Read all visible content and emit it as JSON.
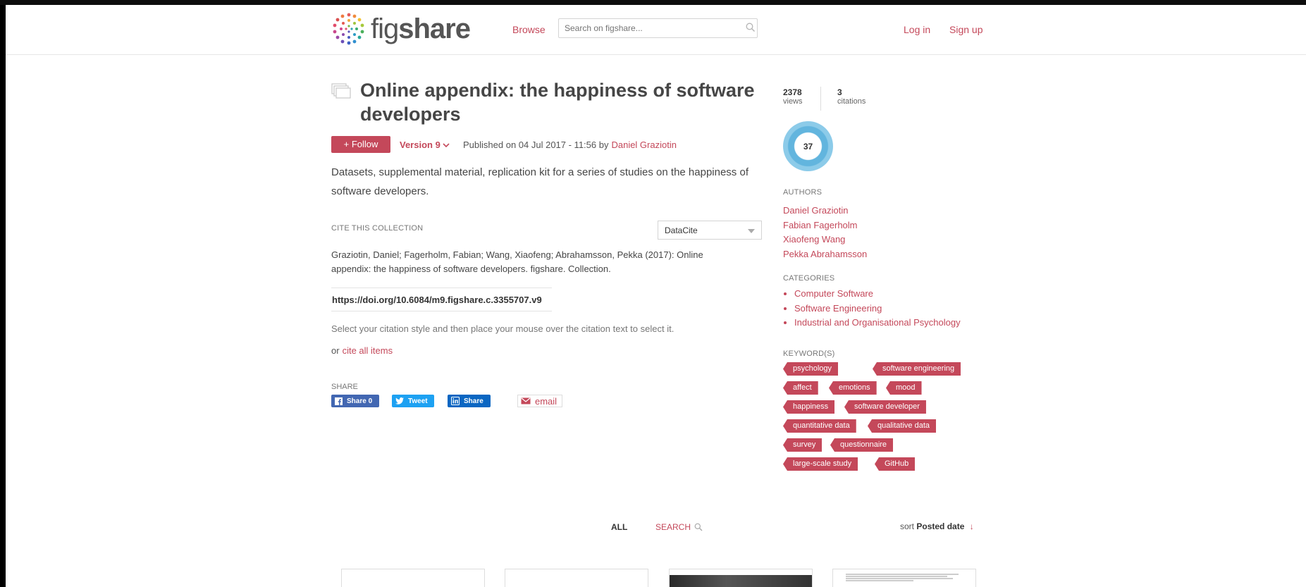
{
  "header": {
    "logo": {
      "prefix": "fig",
      "suffix": "share"
    },
    "browse": "Browse",
    "search_placeholder": "Search on figshare...",
    "login": "Log in",
    "signup": "Sign up"
  },
  "item": {
    "title": "Online appendix: the happiness of software developers",
    "follow": "+ Follow",
    "version": "Version 9",
    "published_text": "Published on 04 Jul 2017 - 11:56 by",
    "published_author": "Daniel Graziotin",
    "description": "Datasets, supplemental material, replication kit for a series of studies on the happiness of software developers."
  },
  "cite": {
    "heading": "CITE THIS COLLECTION",
    "style": "DataCite",
    "citation": "Graziotin, Daniel; Fagerholm, Fabian; Wang, Xiaofeng; Abrahamsson, Pekka (2017): Online appendix: the happiness of software developers. figshare. Collection.",
    "doi": "https://doi.org/10.6084/m9.figshare.c.3355707.v9",
    "help": "Select your citation style and then place your mouse over the citation text to select it.",
    "or": "or",
    "cite_all": "cite all items"
  },
  "share": {
    "heading": "SHARE",
    "facebook": "Share 0",
    "twitter": "Tweet",
    "linkedin": "Share",
    "email": "email"
  },
  "stats": {
    "views_num": "2378",
    "views_label": "views",
    "citations_num": "3",
    "citations_label": "citations",
    "altmetric_score": "37"
  },
  "sidebar": {
    "authors_heading": "AUTHORS",
    "authors": [
      "Daniel Graziotin",
      "Fabian Fagerholm",
      "Xiaofeng Wang",
      "Pekka Abrahamsson"
    ],
    "categories_heading": "CATEGORIES",
    "categories": [
      "Computer Software",
      "Software Engineering",
      "Industrial and Organisational Psychology"
    ],
    "keywords_heading": "KEYWORD(S)",
    "keywords": [
      "psychology",
      "software engineering",
      "affect",
      "emotions",
      "mood",
      "happiness",
      "software developer",
      "quantitative data",
      "qualitative data",
      "survey",
      "questionnaire",
      "large-scale study",
      "GitHub"
    ]
  },
  "items_bar": {
    "all": "ALL",
    "search": "SEARCH",
    "sort_prefix": "sort",
    "sort_value": "Posted date",
    "sort_arrow": "↓"
  },
  "colors": {
    "accent": "#c4485a",
    "facebook": "#4267b2",
    "twitter": "#1da1f2",
    "linkedin": "#0a66c2",
    "altmetric": "#62b5de"
  }
}
